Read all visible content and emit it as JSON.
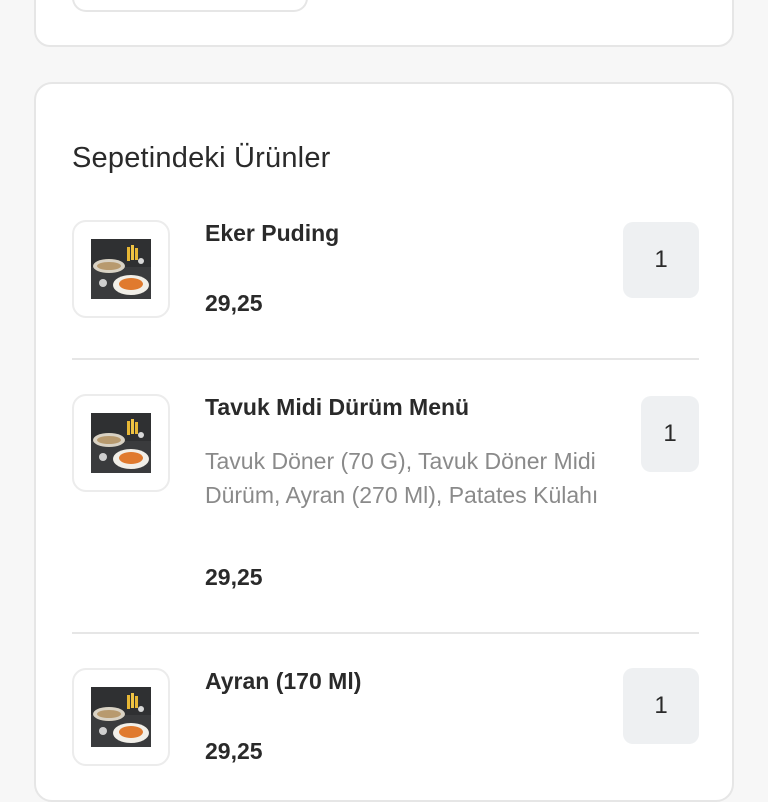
{
  "cart": {
    "title": "Sepetindeki Ürünler",
    "items": [
      {
        "name": "Eker Puding",
        "description": "",
        "price": "29,25",
        "quantity": "1",
        "image_icon": "food-photo-icon"
      },
      {
        "name": "Tavuk Midi Dürüm Menü",
        "description": "Tavuk Döner (70 G), Tavuk Döner Midi Dürüm, Ayran (270 Ml), Patates Külahı",
        "price": "29,25",
        "quantity": "1",
        "image_icon": "food-photo-icon"
      },
      {
        "name": "Ayran (170 Ml)",
        "description": "",
        "price": "29,25",
        "quantity": "1",
        "image_icon": "food-photo-icon"
      }
    ]
  },
  "colors": {
    "card_bg": "#ffffff",
    "page_bg": "#f7f7f7",
    "border": "#e6e6e6",
    "qty_bg": "#eef0f2",
    "text": "#2a2a2a",
    "muted_text": "#8a8a8a"
  }
}
